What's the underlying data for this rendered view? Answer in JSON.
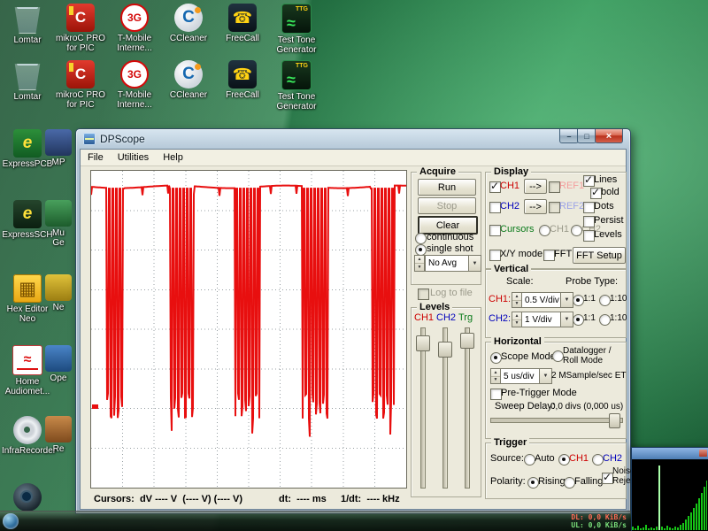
{
  "desktop": {
    "rows": [
      {
        "items": [
          {
            "label": "Lomtar",
            "glyph": ""
          },
          {
            "label": "mikroC PRO for PIC",
            "glyph": "C"
          },
          {
            "label": "T-Mobile Interne...",
            "glyph": "3G"
          },
          {
            "label": "CCleaner",
            "glyph": "C"
          },
          {
            "label": "FreeCall",
            "glyph": "☎"
          },
          {
            "label": "Test Tone Generator",
            "glyph": "TTG"
          }
        ]
      },
      {
        "items": [
          {
            "label": "Lomtar",
            "glyph": ""
          },
          {
            "label": "mikroC PRO for PIC",
            "glyph": "C"
          },
          {
            "label": "T-Mobile Interne...",
            "glyph": "3G"
          },
          {
            "label": "CCleaner",
            "glyph": "C"
          },
          {
            "label": "FreeCall",
            "glyph": "☎"
          },
          {
            "label": "Test Tone Generator",
            "glyph": "TTG"
          }
        ]
      }
    ],
    "left_column": [
      {
        "label": "ExpressPCB",
        "glyph": "e"
      },
      {
        "label": "ExpressSCH",
        "glyph": "e"
      },
      {
        "label": "Hex Editor Neo",
        "glyph": "▦"
      },
      {
        "label": "Home Audiomet...",
        "glyph": "≈"
      },
      {
        "label": "InfraRecorder",
        "glyph": ""
      },
      {
        "label": "",
        "glyph": ""
      }
    ],
    "partial_column": [
      {
        "l1": "MP",
        "l2": ""
      },
      {
        "l1": "Mu",
        "l2": "Ge"
      },
      {
        "l1": "Ne",
        "l2": ""
      },
      {
        "l1": "Ope",
        "l2": ""
      },
      {
        "l1": "Re",
        "l2": ""
      }
    ]
  },
  "win": {
    "title": "DPScope",
    "menu": [
      "File",
      "Utilities",
      "Help"
    ]
  },
  "acquire": {
    "title": "Acquire",
    "run": "Run",
    "stop": "Stop",
    "clear": "Clear",
    "continuous": "continuous",
    "single_shot": "single shot",
    "avg": "No Avg",
    "log": "Log to file"
  },
  "levels": {
    "title": "Levels",
    "ch1": "CH1",
    "ch2": "CH2",
    "trg": "Trg"
  },
  "display": {
    "title": "Display",
    "ch1": "CH1",
    "to_ref": "-->",
    "ref1": "REF1",
    "ch2": "CH2",
    "ref2": "REF2",
    "cursors": "Cursors",
    "cur1": "CH1",
    "cur2": "CH2",
    "lines": "Lines",
    "bold": "bold",
    "dots": "Dots",
    "persist": "Persist",
    "levels": "Levels",
    "xy": "X/Y mode",
    "fft": "FFT",
    "fft_setup": "FFT Setup"
  },
  "vertical": {
    "title": "Vertical",
    "scale": "Scale:",
    "probe": "Probe Type:",
    "ch1": "CH1:",
    "ch2": "CH2:",
    "ch1_scale": "0.5 V/div",
    "ch2_scale": "1 V/div",
    "p11": "1:1",
    "p110": "1:10"
  },
  "horizontal": {
    "title": "Horizontal",
    "scope": "Scope Mode",
    "datalogger1": "Datalogger /",
    "datalogger2": "Roll Mode",
    "tb": "5 us/div",
    "rate": "2 MSample/sec ET",
    "pre": "Pre-Trigger Mode",
    "sweep": "Sweep Delay:",
    "sweep_val": "0,0 divs (0,000 us)"
  },
  "trigger": {
    "title": "Trigger",
    "source": "Source:",
    "auto": "Auto",
    "ch1": "CH1",
    "ch2": "CH2",
    "polarity": "Polarity:",
    "rising": "Rising",
    "falling": "Falling",
    "noise1": "Noise",
    "noise2": "Reject"
  },
  "status": {
    "cursors": "Cursors:  dV ---- V  (---- V) (---- V)",
    "dt": "dt:  ---- ms",
    "idt": "1/dt:  ---- kHz"
  },
  "tray": {
    "dl": "DL: 0,0 KiB/s",
    "ul": "UL: 0,0 KiB/s"
  },
  "waveform": {
    "color": "#e80f0f",
    "high": 0.045,
    "low": 0.742,
    "bursts": [
      [
        0,
        0.048
      ],
      [
        0.104,
        0.248
      ],
      [
        0.324,
        0.456
      ],
      [
        0.535,
        0.67
      ],
      [
        0.752,
        0.887
      ],
      [
        0.963,
        1
      ]
    ]
  },
  "spectrum": {
    "color": "#17c517",
    "peak_color": "#aaffaa",
    "heights": [
      4,
      2,
      5,
      2,
      3,
      6,
      2,
      3,
      2,
      4,
      73,
      4,
      2,
      5,
      3,
      2,
      4,
      3,
      6,
      8,
      12,
      16,
      20,
      25,
      30,
      36,
      42,
      49,
      56
    ]
  },
  "state": {
    "ch1_display": true,
    "ref1": false,
    "ch2_display": false,
    "ref2": false,
    "cursors": false,
    "cur1": false,
    "cur2": false,
    "lines": true,
    "bold": true,
    "dots": false,
    "persist": false,
    "levels": false,
    "xy": false,
    "fft": false,
    "continuous": false,
    "single_shot": true,
    "log": false,
    "p1_11": true,
    "p1_110": false,
    "p2_11": true,
    "p2_110": false,
    "scope_mode": true,
    "datalogger": false,
    "pretrigger": false,
    "src_auto": false,
    "src_ch1": true,
    "src_ch2": false,
    "rising": true,
    "falling": false,
    "noise_reject": true,
    "lvl_ch1": 0.05,
    "lvl_ch2": 0.09,
    "lvl_trg": 0.03,
    "sweep_pos": 0.97
  }
}
